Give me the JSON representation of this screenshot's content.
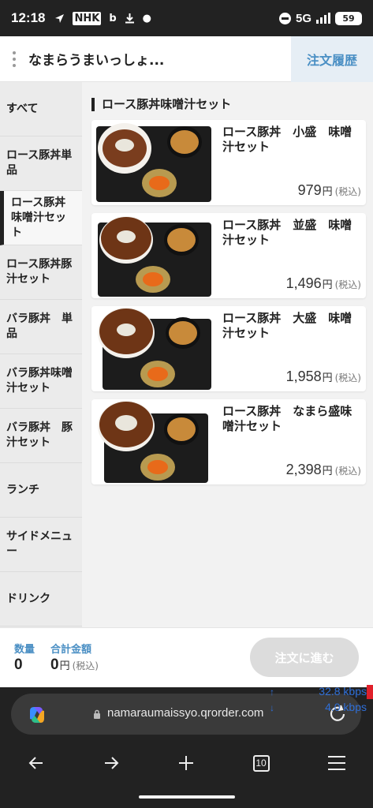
{
  "status_bar": {
    "time": "12:18",
    "network": "5G",
    "battery": "59",
    "icons": [
      "location-arrow-icon",
      "nhk-app-icon",
      "bing-icon",
      "download-icon",
      "notification-dot-icon",
      "do-not-disturb-icon",
      "signal-icon",
      "battery-icon"
    ],
    "nhk_label": "NHK",
    "bing_label": "b"
  },
  "header": {
    "shop_name": "なまらうまいっしょ...",
    "history_label": "注文履歴"
  },
  "sidebar": {
    "items": [
      {
        "label": "すべて"
      },
      {
        "label": "ロース豚丼単品"
      },
      {
        "label": "ロース豚丼味噌汁セット",
        "active": true
      },
      {
        "label": "ロース豚丼豚汁セット"
      },
      {
        "label": "バラ豚丼　単品"
      },
      {
        "label": "バラ豚丼味噌汁セット"
      },
      {
        "label": "バラ豚丼　豚汁セット"
      },
      {
        "label": "ランチ"
      },
      {
        "label": "サイドメニュー"
      },
      {
        "label": "ドリンク"
      }
    ]
  },
  "main": {
    "section_title": "ロース豚丼味噌汁セット",
    "items": [
      {
        "name": "ロース豚丼　小盛　味噌汁セット",
        "price": "979",
        "yen": "円",
        "tax": "(税込)"
      },
      {
        "name": "ロース豚丼　並盛　味噌汁セット",
        "price": "1,496",
        "yen": "円",
        "tax": "(税込)"
      },
      {
        "name": "ロース豚丼　大盛　味噌汁セット",
        "price": "1,958",
        "yen": "円",
        "tax": "(税込)"
      },
      {
        "name": "ロース豚丼　なまら盛味噌汁セット",
        "price": "2,398",
        "yen": "円",
        "tax": "(税込)"
      }
    ]
  },
  "footer": {
    "qty_label": "数量",
    "qty_value": "0",
    "total_label": "合計金額",
    "total_value": "0",
    "total_yen": "円",
    "total_tax": "(税込)",
    "order_button": "注文に進む"
  },
  "browser": {
    "url": "namaraumaissyo.qrorder.com",
    "tab_count": "10",
    "speed_up": "32.8 kbps",
    "speed_down": "4.0 kbps"
  },
  "colors": {
    "accent_blue": "#4a8fc4",
    "header_tab_bg": "#e6eef5",
    "disabled_button": "#dcdcdc",
    "browser_bar": "#222222"
  }
}
